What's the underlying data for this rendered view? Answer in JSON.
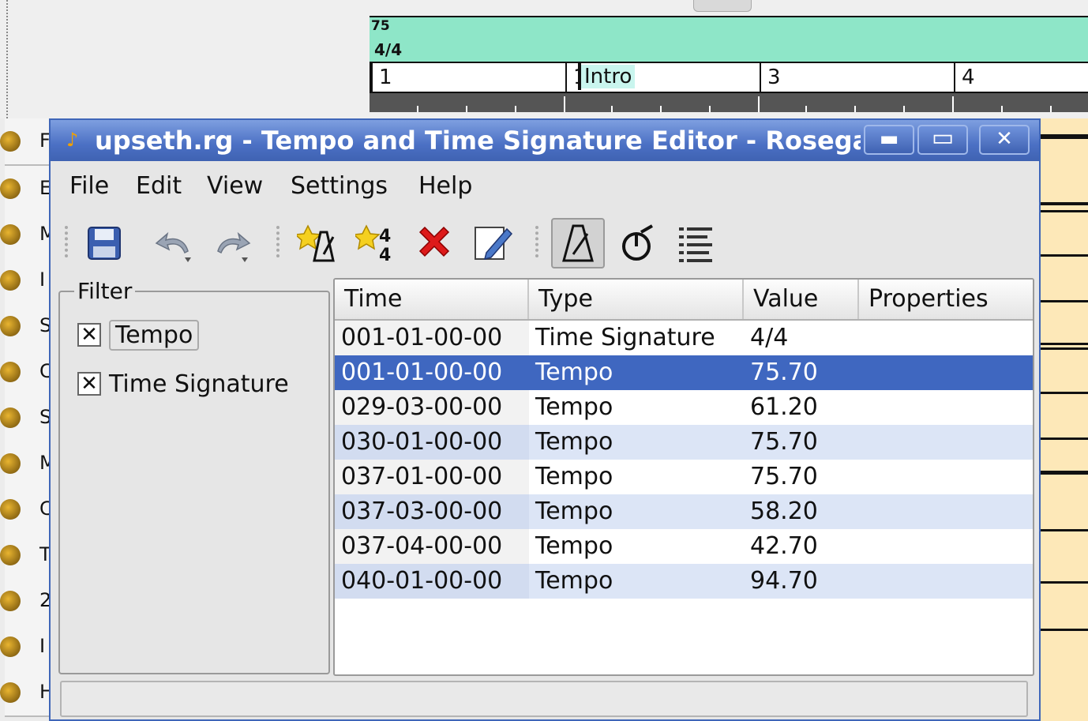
{
  "background": {
    "ruler": {
      "tempo_value": "75",
      "time_signature": "4/4",
      "bar_numbers": [
        "1",
        "1",
        "3",
        "4"
      ],
      "marker": "Intro"
    },
    "tracks": [
      "F",
      "E",
      "M",
      "I",
      "S",
      "C",
      "S",
      "M",
      "C",
      "T",
      "2",
      "I",
      "H"
    ]
  },
  "dialog": {
    "title": "upseth.rg - Tempo and Time Signature Editor - Rosegarden",
    "window_buttons": {
      "minimize": "▬",
      "maximize": "▭",
      "close": "✕"
    },
    "menu": [
      "File",
      "Edit",
      "View",
      "Settings",
      "Help"
    ],
    "toolbar": [
      {
        "name": "save-icon"
      },
      {
        "name": "undo-icon"
      },
      {
        "name": "redo-icon"
      },
      {
        "name": "insert-tempo-icon"
      },
      {
        "name": "insert-time-signature-icon"
      },
      {
        "name": "delete-icon"
      },
      {
        "name": "edit-icon"
      },
      {
        "name": "tempo-view-icon",
        "active": true
      },
      {
        "name": "time-signature-view-icon"
      },
      {
        "name": "list-view-icon"
      }
    ],
    "filter": {
      "title": "Filter",
      "options": [
        {
          "label": "Tempo",
          "checked": true
        },
        {
          "label": "Time Signature",
          "checked": true
        }
      ]
    },
    "list": {
      "columns": [
        "Time",
        "Type",
        "Value",
        "Properties"
      ],
      "rows": [
        {
          "time": "001-01-00-00",
          "type": "Time Signature",
          "value": "4/4",
          "properties": ""
        },
        {
          "time": "001-01-00-00",
          "type": "Tempo",
          "value": "75.70",
          "properties": "",
          "selected": true
        },
        {
          "time": "029-03-00-00",
          "type": "Tempo",
          "value": "61.20",
          "properties": ""
        },
        {
          "time": "030-01-00-00",
          "type": "Tempo",
          "value": "75.70",
          "properties": ""
        },
        {
          "time": "037-01-00-00",
          "type": "Tempo",
          "value": "75.70",
          "properties": ""
        },
        {
          "time": "037-03-00-00",
          "type": "Tempo",
          "value": "58.20",
          "properties": ""
        },
        {
          "time": "037-04-00-00",
          "type": "Tempo",
          "value": "42.70",
          "properties": ""
        },
        {
          "time": "040-01-00-00",
          "type": "Tempo",
          "value": "94.70",
          "properties": ""
        }
      ]
    },
    "status": ""
  },
  "colors": {
    "titlebar": "#4b70c4",
    "selection": "#3f67c0",
    "alt_row": "#dce5f6",
    "ruler_bg": "#8ee6c8",
    "marker_bg": "#c9f5ee",
    "segment_bg": "#fde8b8"
  }
}
